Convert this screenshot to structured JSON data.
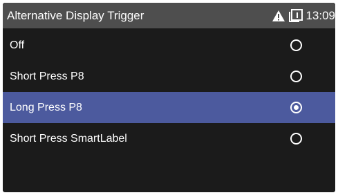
{
  "header": {
    "title": "Alternative Display Trigger",
    "status_icons": [
      "warning-icon",
      "document-icon"
    ],
    "time": "13:09"
  },
  "options": [
    {
      "label": "Off",
      "selected": false
    },
    {
      "label": "Short Press P8",
      "selected": false
    },
    {
      "label": "Long Press P8",
      "selected": true
    },
    {
      "label": "Short Press SmartLabel",
      "selected": false
    }
  ],
  "colors": {
    "header_bg": "#4e4e4e",
    "background": "#1b1b1b",
    "selection": "#4c5a9e",
    "text": "#ffffff"
  }
}
